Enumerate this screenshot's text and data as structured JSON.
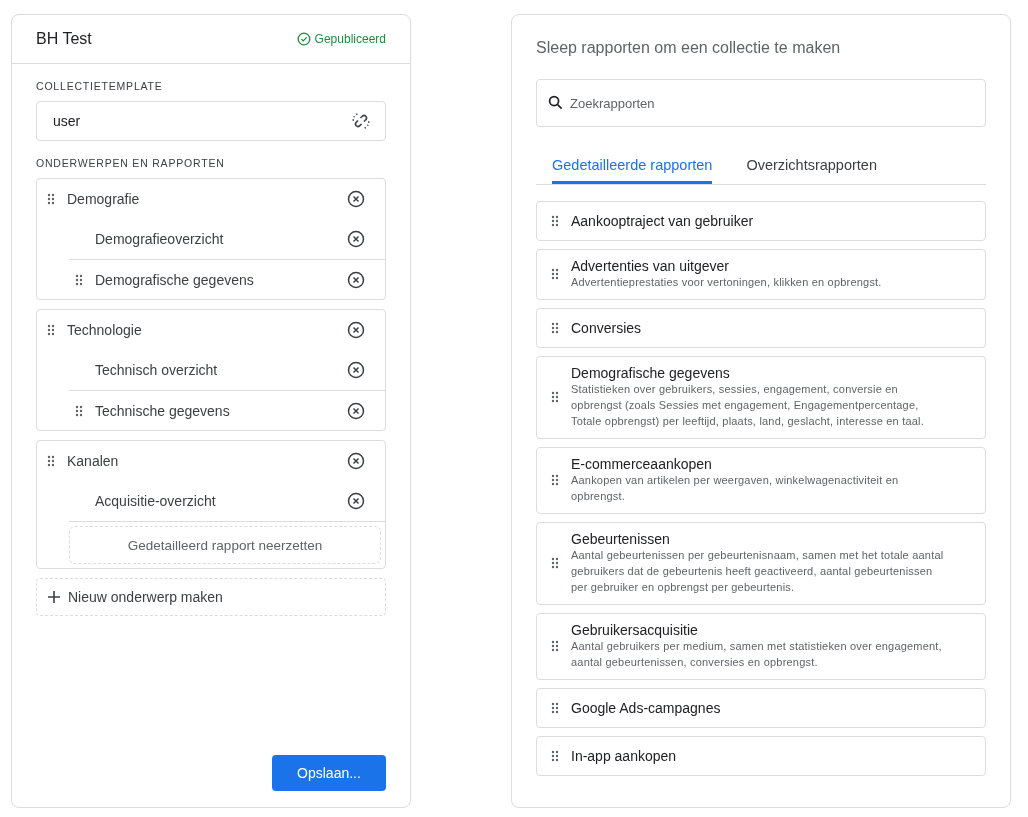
{
  "collection": {
    "title": "BH Test",
    "status": {
      "label": "Gepubliceerd",
      "published": true
    },
    "template_label": "COLLECTIETEMPLATE",
    "template_value": "user",
    "topics_label": "ONDERWERPEN EN RAPPORTEN",
    "topics": [
      {
        "name": "Demografie",
        "children": [
          {
            "name": "Demografieoverzicht",
            "draggable": false
          },
          {
            "name": "Demografische gegevens",
            "draggable": true
          }
        ]
      },
      {
        "name": "Technologie",
        "children": [
          {
            "name": "Technisch overzicht",
            "draggable": false
          },
          {
            "name": "Technische gegevens",
            "draggable": true
          }
        ]
      },
      {
        "name": "Kanalen",
        "children": [
          {
            "name": "Acquisitie-overzicht",
            "draggable": false
          }
        ],
        "drop_zone": "Gedetailleerd rapport neerzetten"
      }
    ],
    "new_topic": "Nieuw onderwerp maken",
    "save_button": "Opslaan..."
  },
  "library": {
    "heading": "Sleep rapporten om een collectie te maken",
    "search": {
      "placeholder": "Zoekrapporten"
    },
    "tabs": [
      {
        "label": "Gedetailleerde rapporten",
        "selected": true
      },
      {
        "label": "Overzichtsrapporten",
        "selected": false
      }
    ],
    "reports": [
      {
        "title": "Aankooptraject van gebruiker"
      },
      {
        "title": "Advertenties van uitgever",
        "description": "Advertentieprestaties voor vertoningen, klikken en opbrengst."
      },
      {
        "title": "Conversies"
      },
      {
        "title": "Demografische gegevens",
        "description": "Statistieken over gebruikers, sessies, engagement, conversie en opbrengst (zoals Sessies met engagement, Engagementpercentage, Totale opbrengst) per leeftijd, plaats, land, geslacht, interesse en taal."
      },
      {
        "title": "E-commerceaankopen",
        "description": "Aankopen van artikelen per weergaven, winkelwagenactiviteit en opbrengst."
      },
      {
        "title": "Gebeurtenissen",
        "description": "Aantal gebeurtenissen per gebeurtenisnaam, samen met het totale aantal gebruikers dat de gebeurtenis heeft geactiveerd, aantal gebeurtenissen per gebruiker en opbrengst per gebeurtenis."
      },
      {
        "title": "Gebruikersacquisitie",
        "description": "Aantal gebruikers per medium, samen met statistieken over engagement, aantal gebeurtenissen, conversies en opbrengst."
      },
      {
        "title": "Google Ads-campagnes"
      },
      {
        "title": "In-app aankopen"
      }
    ]
  }
}
